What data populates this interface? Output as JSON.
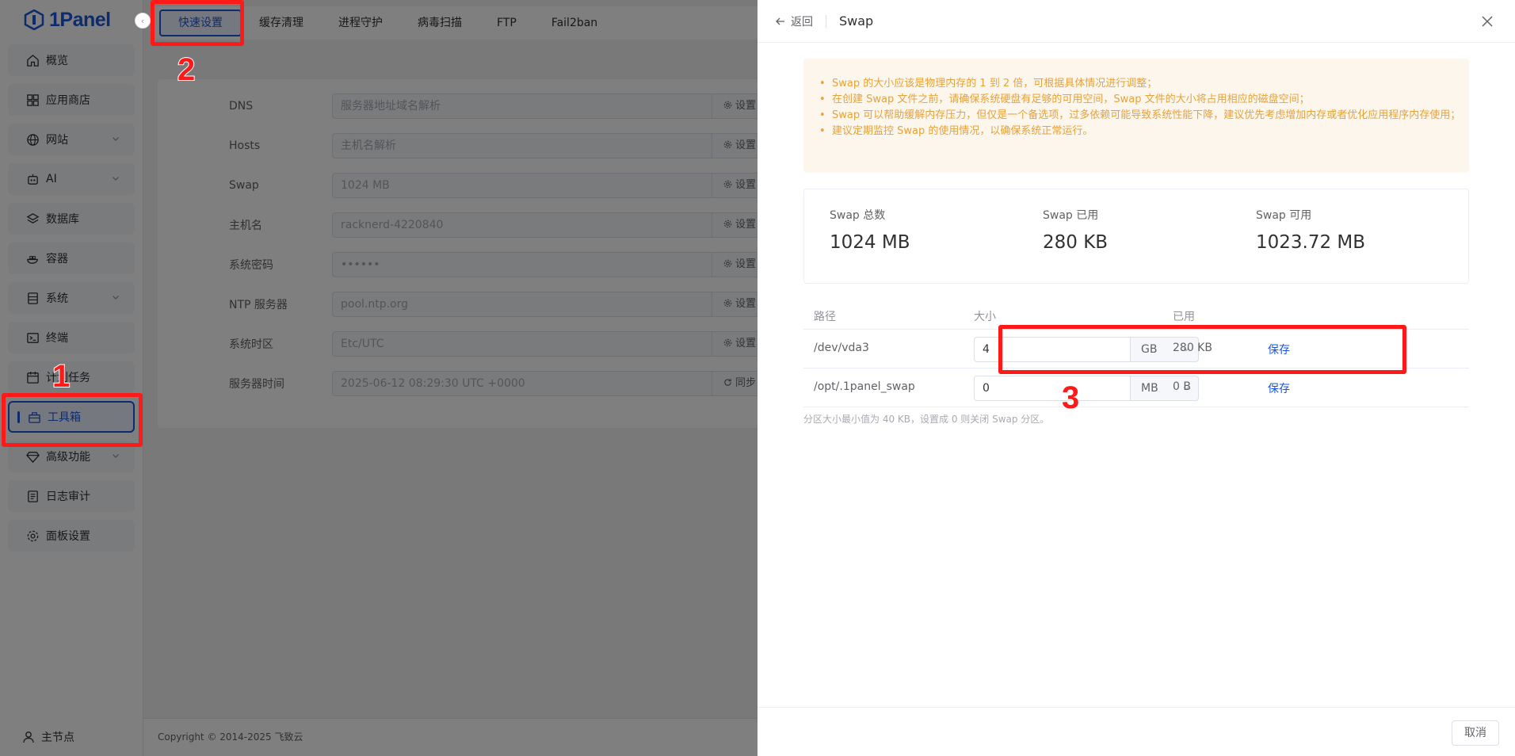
{
  "app": {
    "logo_text": "1Panel"
  },
  "sidebar": {
    "items": [
      {
        "label": "概览",
        "icon": "home-icon",
        "expandable": false
      },
      {
        "label": "应用商店",
        "icon": "grid-icon",
        "expandable": false
      },
      {
        "label": "网站",
        "icon": "globe-icon",
        "expandable": true
      },
      {
        "label": "AI",
        "icon": "robot-icon",
        "expandable": true
      },
      {
        "label": "数据库",
        "icon": "layers-icon",
        "expandable": false
      },
      {
        "label": "容器",
        "icon": "docker-icon",
        "expandable": false
      },
      {
        "label": "系统",
        "icon": "server-icon",
        "expandable": true
      },
      {
        "label": "终端",
        "icon": "terminal-icon",
        "expandable": false
      },
      {
        "label": "计划任务",
        "icon": "calendar-icon",
        "expandable": false
      },
      {
        "label": "工具箱",
        "icon": "toolbox-icon",
        "expandable": false,
        "active": true
      },
      {
        "label": "高级功能",
        "icon": "diamond-icon",
        "expandable": true
      },
      {
        "label": "日志审计",
        "icon": "log-icon",
        "expandable": false
      },
      {
        "label": "面板设置",
        "icon": "gear-icon",
        "expandable": false
      }
    ],
    "footer_node": "主节点"
  },
  "tabs": [
    "快速设置",
    "缓存清理",
    "进程守护",
    "病毒扫描",
    "FTP",
    "Fail2ban"
  ],
  "settings_form": [
    {
      "label": "DNS",
      "value": "服务器地址域名解析",
      "action": "设置"
    },
    {
      "label": "Hosts",
      "value": "主机名解析",
      "action": "设置"
    },
    {
      "label": "Swap",
      "value": "1024 MB",
      "action": "设置"
    },
    {
      "label": "主机名",
      "value": "racknerd-4220840",
      "action": "设置"
    },
    {
      "label": "系统密码",
      "value": "••••••",
      "action": "设置"
    },
    {
      "label": "NTP 服务器",
      "value": "pool.ntp.org",
      "action": "设置"
    },
    {
      "label": "系统时区",
      "value": "Etc/UTC",
      "action": "设置"
    },
    {
      "label": "服务器时间",
      "value": "2025-06-12 08:29:30 UTC +0000",
      "action": "同步"
    }
  ],
  "copyright": "Copyright © 2014-2025 飞致云",
  "drawer": {
    "back_label": "返回",
    "title": "Swap",
    "tips": [
      "Swap 的大小应该是物理内存的 1 到 2 倍，可根据具体情况进行调整；",
      "在创建 Swap 文件之前，请确保系统硬盘有足够的可用空间，Swap 文件的大小将占用相应的磁盘空间；",
      "Swap 可以帮助缓解内存压力，但仅是一个备选项，过多依赖可能导致系统性能下降，建议优先考虑增加内存或者优化应用程序内存使用；",
      "建议定期监控 Swap 的使用情况，以确保系统正常运行。"
    ],
    "stats": [
      {
        "label": "Swap 总数",
        "value": "1024 MB"
      },
      {
        "label": "Swap 已用",
        "value": "280 KB"
      },
      {
        "label": "Swap 可用",
        "value": "1023.72 MB"
      }
    ],
    "table": {
      "headers": {
        "path": "路径",
        "size": "大小",
        "used": "已用"
      },
      "rows": [
        {
          "path": "/dev/vda3",
          "size": "4",
          "unit": "GB",
          "used": "280 KB",
          "action": "保存"
        },
        {
          "path": "/opt/.1panel_swap",
          "size": "0",
          "unit": "MB",
          "used": "0 B",
          "action": "保存"
        }
      ]
    },
    "hint": "分区大小最小值为 40 KB，设置成 0 则关闭 Swap 分区。",
    "cancel_label": "取消"
  },
  "annotations": {
    "n1": "1",
    "n2": "2",
    "n3": "3"
  },
  "colors": {
    "accent": "#1a56db",
    "warning": "#e6a23c",
    "annotation": "#ff1a1a"
  }
}
